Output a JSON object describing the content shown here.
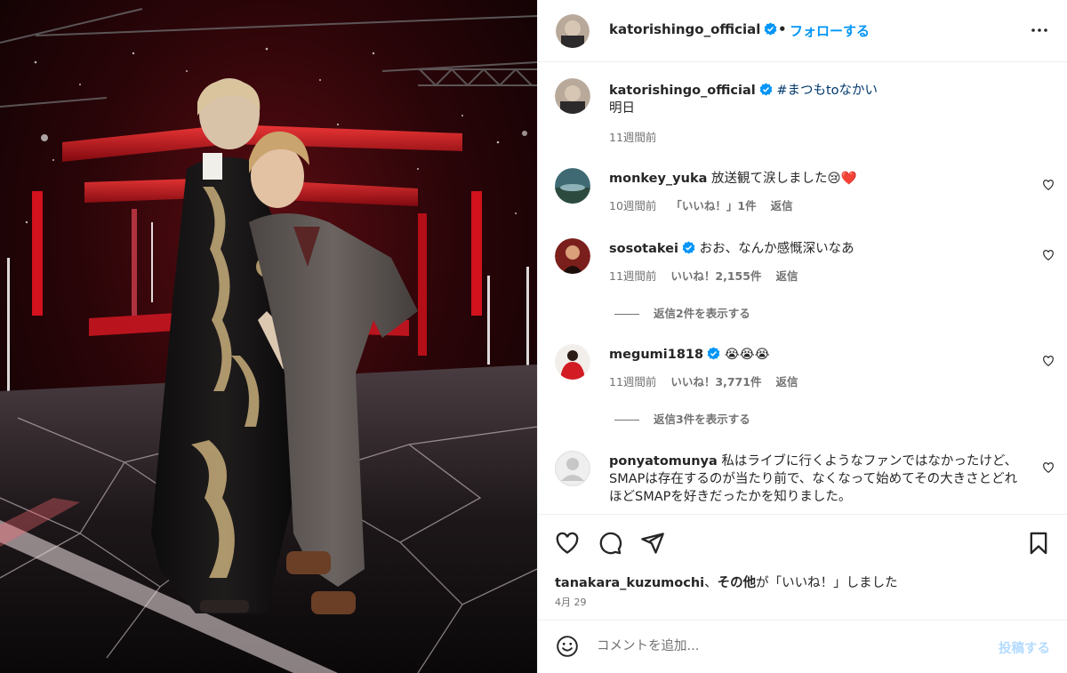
{
  "post_header": {
    "username": "katorishingo_official",
    "separator": "•",
    "follow_label": "フォローする"
  },
  "caption": {
    "username": "katorishingo_official",
    "hashtag": "#まつもtoなかい",
    "text": "明日",
    "time": "11週間前"
  },
  "comments": [
    {
      "username": "monkey_yuka",
      "text": "放送観て涙しました😢❤️",
      "time": "10週間前",
      "likes": "「いいね！」1件",
      "reply": "返信"
    },
    {
      "username": "sosotakei",
      "text": "おお、なんか感慨深いなあ",
      "time": "11週間前",
      "likes": "いいね！2,155件",
      "reply": "返信",
      "view_replies": "返信2件を表示する"
    },
    {
      "username": "megumi1818",
      "text": "😭😭😭",
      "time": "11週間前",
      "likes": "いいね！3,771件",
      "reply": "返信",
      "view_replies": "返信3件を表示する"
    },
    {
      "username": "ponyatomunya",
      "text": "私はライブに行くようなファンではなかったけど、SMAPは存在するのが当たり前で、なくなって始めてその大きさとどれほどSMAPを好きだったかを知りました。"
    }
  ],
  "actions": {
    "liked_by_user": "tanakara_kuzumochi",
    "liked_by_sep": "、",
    "liked_by_others": "その他",
    "liked_by_suffix": "が「いいね！」しました",
    "date": "4月 29"
  },
  "add_comment": {
    "placeholder": "コメントを追加...",
    "post_label": "投稿する"
  },
  "colors": {
    "accent": "#0095f6",
    "verified": "#0095f6",
    "muted": "#737373",
    "post_disabled": "#b3dbff"
  }
}
